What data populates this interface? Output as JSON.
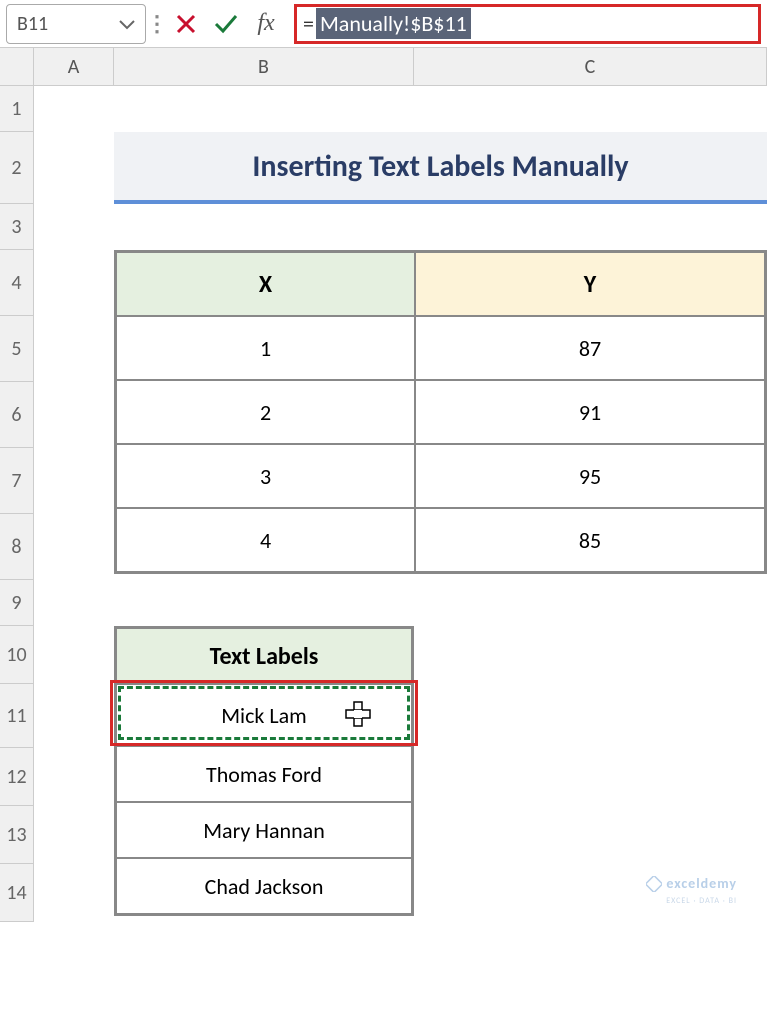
{
  "formula_bar": {
    "cell_ref": "B11",
    "formula_equals": "=",
    "formula_ref": "Manually!$B$11"
  },
  "columns": [
    "A",
    "B",
    "C"
  ],
  "rows": [
    "1",
    "2",
    "3",
    "4",
    "5",
    "6",
    "7",
    "8",
    "9",
    "10",
    "11",
    "12",
    "13",
    "14"
  ],
  "title": "Inserting Text Labels Manually",
  "table1": {
    "headers": {
      "x": "X",
      "y": "Y"
    },
    "rows": [
      {
        "x": "1",
        "y": "87"
      },
      {
        "x": "2",
        "y": "91"
      },
      {
        "x": "3",
        "y": "95"
      },
      {
        "x": "4",
        "y": "85"
      }
    ]
  },
  "table2": {
    "header": "Text Labels",
    "rows": [
      "Mick Lam",
      "Thomas Ford",
      "Mary Hannan",
      "Chad Jackson"
    ]
  },
  "watermark": {
    "name": "exceldemy",
    "tagline": "EXCEL · DATA · BI"
  }
}
